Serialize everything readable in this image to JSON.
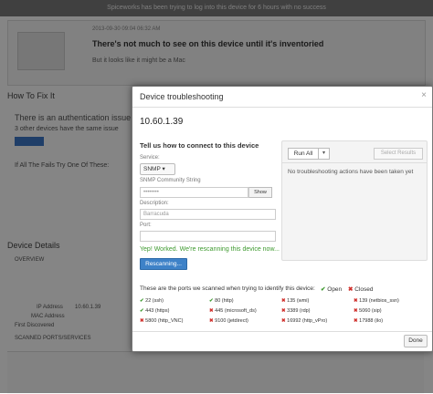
{
  "background": {
    "banner": "Spiceworks has been trying to log into this device for 6 hours with no success",
    "card_date": "2013-09-30 09:04 06:32 AM",
    "card_title": "There's not much to see on this device until it's inventoried",
    "card_sub": "But it looks like it might be a Mac",
    "how_to_fix": "How To Fix It",
    "auth_issue": "There is an authentication issue w",
    "other_devices": "3 other devices have the same issue",
    "fix_all": "If All The Fails Try One Of These:",
    "device_details": "Device Details",
    "overview": "OVERVIEW",
    "ip_address_label": "IP Address",
    "ip_address_value": "10.60.1.39",
    "mac_address_label": "MAC Address",
    "first_discovered_label": "First Discovered",
    "ports_header": "SCANNED PORTS/SERVICES"
  },
  "modal": {
    "title": "Device troubleshooting",
    "close": "×",
    "ip": "10.60.1.39",
    "connect_title": "Tell us how to connect to this device",
    "service_label": "Service:",
    "service_value": "SNMP ▾",
    "community_label": "SNMP Community String",
    "community_value": "••••••••",
    "show_label": "Show",
    "description_label": "Description:",
    "description_value": "Barracuda",
    "port_label": "Port:",
    "port_value": "",
    "success_msg": "Yep! Worked. We're rescanning this device now...",
    "rescan_label": "Rescanning...",
    "run_all": "Run All",
    "run_all_caret": "▾",
    "select_results": "Select Results",
    "no_actions": "No troubleshooting actions have been taken yet",
    "ports_title": "These are the ports we scanned when trying to identify this device:",
    "legend_open": "Open",
    "legend_closed": "Closed",
    "done": "Done"
  },
  "ports": [
    {
      "label": "22 (ssh)",
      "open": true
    },
    {
      "label": "80 (http)",
      "open": true
    },
    {
      "label": "135 (wmi)",
      "open": false
    },
    {
      "label": "139 (netbios_ssn)",
      "open": false
    },
    {
      "label": "443 (https)",
      "open": true
    },
    {
      "label": "445 (microsoft_ds)",
      "open": false
    },
    {
      "label": "3389 (rdp)",
      "open": false
    },
    {
      "label": "5060 (sip)",
      "open": false
    },
    {
      "label": "5800 (http_VNC)",
      "open": false
    },
    {
      "label": "9100 (jetdirect)",
      "open": false
    },
    {
      "label": "16992 (http_vPro)",
      "open": false
    },
    {
      "label": "17988 (ilo)",
      "open": false
    }
  ],
  "icons": {
    "open": "check-icon",
    "closed": "cross-icon"
  },
  "colors": {
    "open": "#3e9a2f",
    "closed": "#d0312d",
    "accent": "#3e82c8"
  }
}
